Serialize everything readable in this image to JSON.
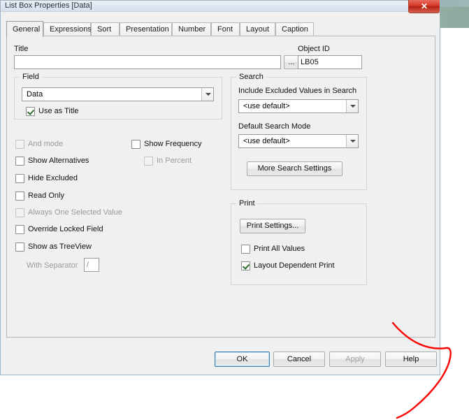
{
  "window": {
    "title": "List Box Properties [Data]",
    "close_label": "✕"
  },
  "tabs": [
    {
      "label": "General",
      "active": true
    },
    {
      "label": "Expressions",
      "active": false
    },
    {
      "label": "Sort",
      "active": false
    },
    {
      "label": "Presentation",
      "active": false
    },
    {
      "label": "Number",
      "active": false
    },
    {
      "label": "Font",
      "active": false
    },
    {
      "label": "Layout",
      "active": false
    },
    {
      "label": "Caption",
      "active": false
    }
  ],
  "general": {
    "title_label": "Title",
    "title_value": "",
    "title_browse_label": "...",
    "object_id_label": "Object ID",
    "object_id_value": "LB05",
    "field_group_label": "Field",
    "field_value": "Data",
    "use_as_title_label": "Use as Title",
    "use_as_title_checked": true,
    "checkboxes": [
      {
        "label": "And mode",
        "checked": false,
        "disabled": true
      },
      {
        "label": "Show Frequency",
        "checked": false,
        "disabled": false
      },
      {
        "label": "Show Alternatives",
        "checked": false,
        "disabled": false
      },
      {
        "label": "In Percent",
        "checked": false,
        "disabled": true
      },
      {
        "label": "Hide Excluded",
        "checked": false,
        "disabled": false
      },
      {
        "label": "Read Only",
        "checked": false,
        "disabled": false
      },
      {
        "label": "Always One Selected Value",
        "checked": false,
        "disabled": true
      },
      {
        "label": "Override Locked Field",
        "checked": false,
        "disabled": false
      },
      {
        "label": "Show as TreeView",
        "checked": false,
        "disabled": false
      }
    ],
    "with_separator_label": "With Separator",
    "with_separator_value": "/"
  },
  "search": {
    "group_label": "Search",
    "include_excluded_label": "Include Excluded Values in Search",
    "include_excluded_value": "<use default>",
    "default_search_mode_label": "Default Search Mode",
    "default_search_mode_value": "<use default>",
    "more_search_settings_label": "More Search Settings"
  },
  "print": {
    "group_label": "Print",
    "print_settings_label": "Print Settings...",
    "print_all_values_label": "Print All Values",
    "print_all_values_checked": false,
    "layout_dependent_print_label": "Layout Dependent Print",
    "layout_dependent_print_checked": true
  },
  "footer": {
    "ok_label": "OK",
    "cancel_label": "Cancel",
    "apply_label": "Apply",
    "apply_disabled": true,
    "help_label": "Help"
  },
  "colors": {
    "accent": "#3c7fb1",
    "close_red": "#d8392a",
    "annotation_red": "#ff0000",
    "dialog_bg": "#f0f0f0"
  }
}
